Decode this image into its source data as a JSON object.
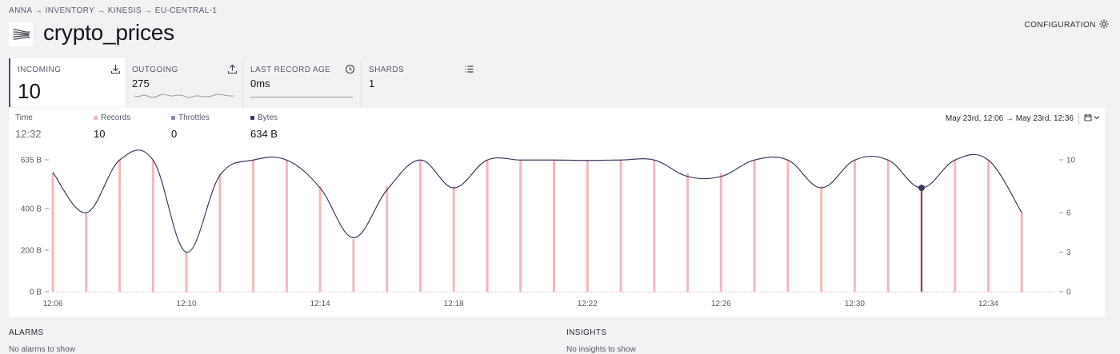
{
  "breadcrumb": "ANNA → INVENTORY → KINESIS → EU-CENTRAL-1",
  "page_title": "crypto_prices",
  "configuration_label": "CONFIGURATION",
  "tiles": [
    {
      "label": "INCOMING",
      "value": "10",
      "icon": "download-icon"
    },
    {
      "label": "OUTGOING",
      "value": "275",
      "icon": "upload-icon"
    },
    {
      "label": "LAST RECORD AGE",
      "value": "0ms",
      "icon": "clock-icon"
    },
    {
      "label": "SHARDS",
      "value": "1",
      "icon": "list-icon"
    }
  ],
  "legend": {
    "time_label": "Time",
    "time_value": "12:32",
    "records_label": "Records",
    "records_value": "10",
    "throttles_label": "Throttles",
    "throttles_value": "0",
    "bytes_label": "Bytes",
    "bytes_value": "634 B"
  },
  "date_range": "May 23rd, 12:06 → May 23rd, 12:36",
  "colors": {
    "records": "#f2b8bb",
    "throttles": "#8a8aa6",
    "bytes": "#3b3b63",
    "accent": "#4a4a78"
  },
  "chart_data": {
    "type": "line",
    "x": [
      "12:06",
      "12:07",
      "12:08",
      "12:09",
      "12:10",
      "12:11",
      "12:12",
      "12:13",
      "12:14",
      "12:15",
      "12:16",
      "12:17",
      "12:18",
      "12:19",
      "12:20",
      "12:21",
      "12:22",
      "12:23",
      "12:24",
      "12:25",
      "12:26",
      "12:27",
      "12:28",
      "12:29",
      "12:30",
      "12:31",
      "12:32",
      "12:33",
      "12:34",
      "12:35",
      "12:36"
    ],
    "x_ticks": [
      "12:06",
      "12:10",
      "12:14",
      "12:18",
      "12:22",
      "12:26",
      "12:30",
      "12:34"
    ],
    "series": [
      {
        "name": "Bytes",
        "type": "line",
        "axis": "left",
        "values": [
          575,
          380,
          634,
          634,
          190,
          560,
          634,
          634,
          500,
          260,
          490,
          634,
          500,
          634,
          634,
          634,
          632,
          634,
          634,
          555,
          555,
          634,
          634,
          500,
          634,
          634,
          500,
          634,
          634,
          380
        ]
      },
      {
        "name": "Records",
        "type": "bar",
        "axis": "right",
        "values": [
          9,
          6,
          10,
          10,
          3,
          9,
          10,
          10,
          8,
          4,
          8,
          10,
          8,
          10,
          10,
          10,
          10,
          10,
          10,
          9,
          9,
          10,
          10,
          8,
          10,
          10,
          8,
          10,
          10,
          6
        ]
      },
      {
        "name": "Throttles",
        "type": "bar",
        "axis": "right",
        "values": [
          0,
          0,
          0,
          0,
          0,
          0,
          0,
          0,
          0,
          0,
          0,
          0,
          0,
          0,
          0,
          0,
          0,
          0,
          0,
          0,
          0,
          0,
          0,
          0,
          0,
          0,
          0,
          0,
          0,
          0
        ]
      }
    ],
    "y_left": {
      "ticks": [
        "0 B",
        "200 B",
        "400 B",
        "635 B"
      ],
      "tick_values": [
        0,
        200,
        400,
        635
      ],
      "range": [
        0,
        635
      ]
    },
    "y_right": {
      "ticks": [
        "0",
        "3",
        "6",
        "10"
      ],
      "tick_values": [
        0,
        3,
        6,
        10
      ],
      "range": [
        0,
        10
      ]
    },
    "highlight_x": "12:32",
    "grid": false
  },
  "footer": {
    "alarms_label": "ALARMS",
    "insights_label": "INSIGHTS",
    "alarms_text": "No alarms to show",
    "insights_text": "No insights to show"
  }
}
